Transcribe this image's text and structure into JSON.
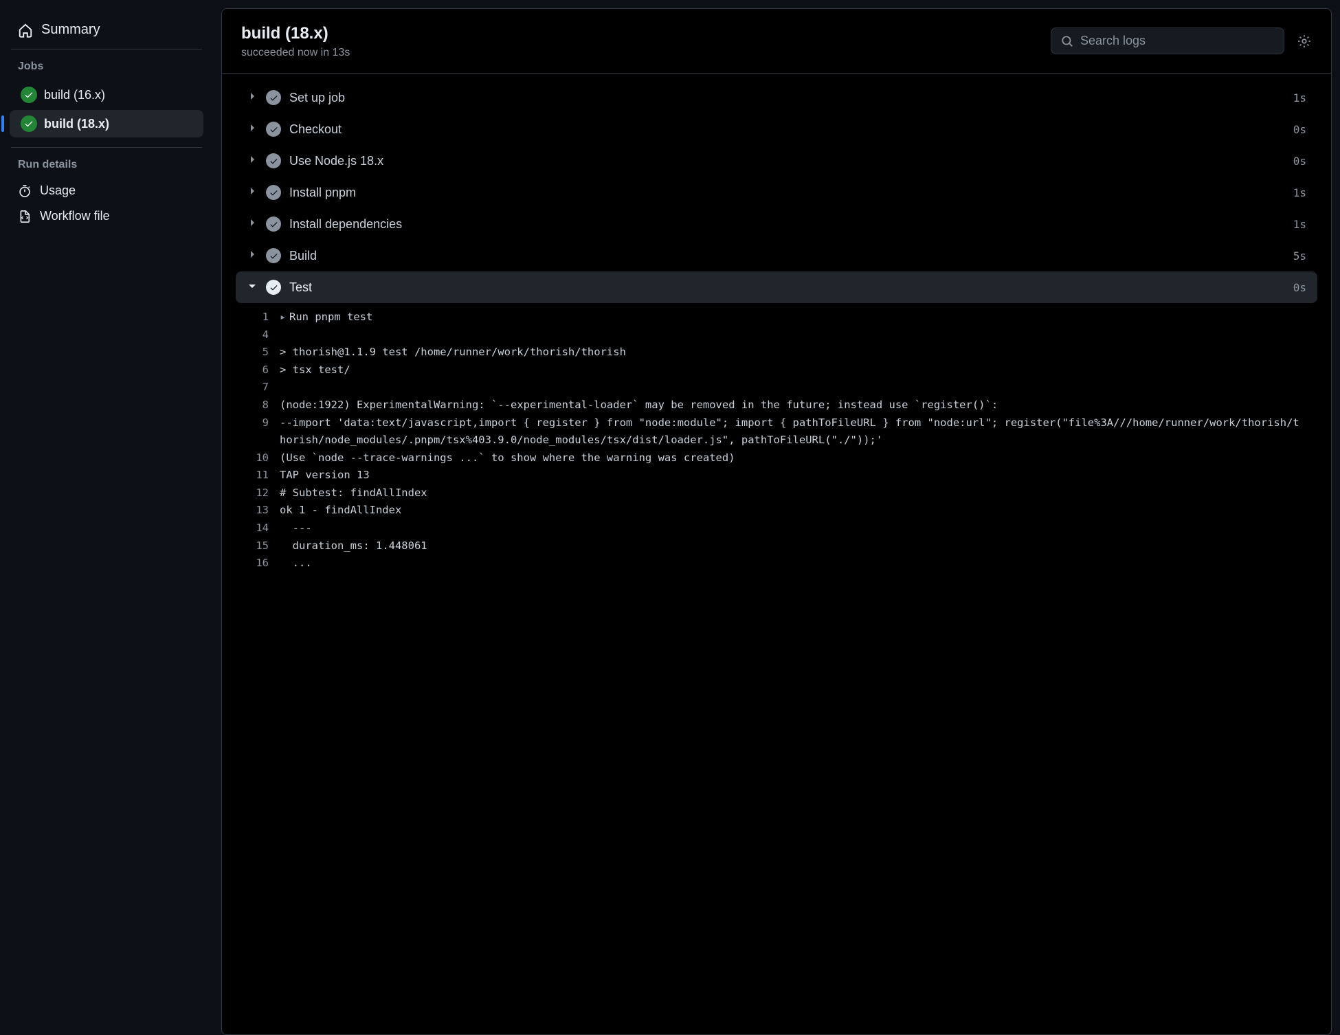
{
  "sidebar": {
    "summary_label": "Summary",
    "jobs_heading": "Jobs",
    "jobs": [
      {
        "label": "build (16.x)",
        "selected": false
      },
      {
        "label": "build (18.x)",
        "selected": true
      }
    ],
    "run_details_heading": "Run details",
    "usage_label": "Usage",
    "workflow_file_label": "Workflow file"
  },
  "header": {
    "title": "build (18.x)",
    "subtitle": "succeeded now in 13s",
    "search_placeholder": "Search logs"
  },
  "steps": [
    {
      "name": "Set up job",
      "duration": "1s",
      "expanded": false
    },
    {
      "name": "Checkout",
      "duration": "0s",
      "expanded": false
    },
    {
      "name": "Use Node.js 18.x",
      "duration": "0s",
      "expanded": false
    },
    {
      "name": "Install pnpm",
      "duration": "1s",
      "expanded": false
    },
    {
      "name": "Install dependencies",
      "duration": "1s",
      "expanded": false
    },
    {
      "name": "Build",
      "duration": "5s",
      "expanded": false
    },
    {
      "name": "Test",
      "duration": "0s",
      "expanded": true
    }
  ],
  "log": {
    "run_line": "Run pnpm test",
    "lines": [
      {
        "n": "1",
        "text": "Run pnpm test",
        "caret": true
      },
      {
        "n": "4",
        "text": ""
      },
      {
        "n": "5",
        "text": "> thorish@1.1.9 test /home/runner/work/thorish/thorish"
      },
      {
        "n": "6",
        "text": "> tsx test/"
      },
      {
        "n": "7",
        "text": ""
      },
      {
        "n": "8",
        "text": "(node:1922) ExperimentalWarning: `--experimental-loader` may be removed in the future; instead use `register()`:"
      },
      {
        "n": "9",
        "text": "--import 'data:text/javascript,import { register } from \"node:module\"; import { pathToFileURL } from \"node:url\"; register(\"file%3A///home/runner/work/thorish/thorish/node_modules/.pnpm/tsx%403.9.0/node_modules/tsx/dist/loader.js\", pathToFileURL(\"./\"));'"
      },
      {
        "n": "10",
        "text": "(Use `node --trace-warnings ...` to show where the warning was created)"
      },
      {
        "n": "11",
        "text": "TAP version 13"
      },
      {
        "n": "12",
        "text": "# Subtest: findAllIndex"
      },
      {
        "n": "13",
        "text": "ok 1 - findAllIndex"
      },
      {
        "n": "14",
        "text": "  ---"
      },
      {
        "n": "15",
        "text": "  duration_ms: 1.448061"
      },
      {
        "n": "16",
        "text": "  ..."
      }
    ]
  }
}
